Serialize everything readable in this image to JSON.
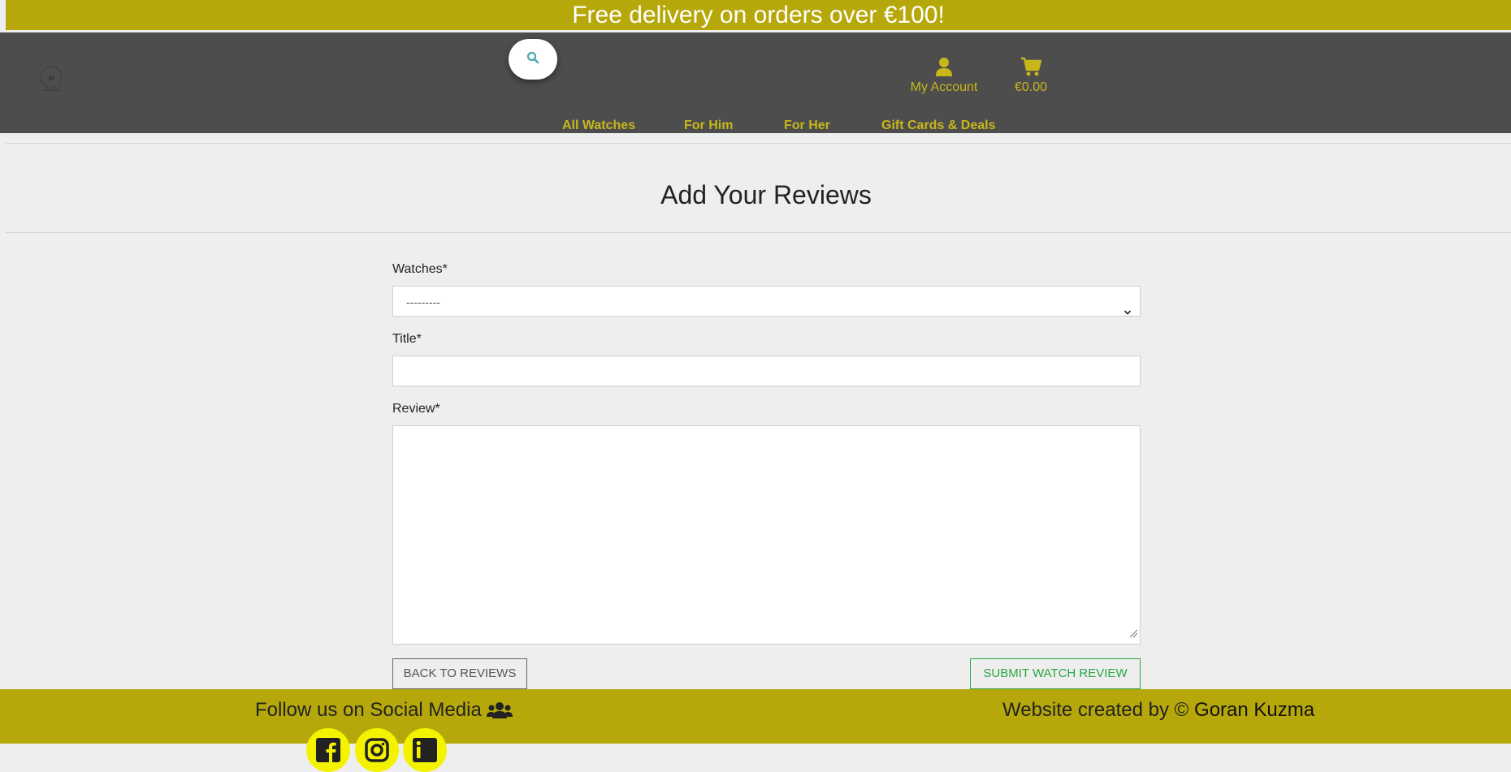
{
  "promo": {
    "text": "Free delivery on orders over €100!"
  },
  "header": {
    "logo_icon": "watch-brand-logo",
    "search_icon": "search-icon",
    "account": {
      "icon": "user-icon",
      "label": "My Account"
    },
    "cart": {
      "icon": "shopping-cart-icon",
      "total": "€0.00"
    },
    "nav": [
      {
        "label": "All Watches"
      },
      {
        "label": "For Him"
      },
      {
        "label": "For Her"
      },
      {
        "label": "Gift Cards & Deals"
      }
    ]
  },
  "main": {
    "title": "Add Your Reviews",
    "form": {
      "watches_label": "Watches*",
      "watches_selected": "---------",
      "title_label": "Title*",
      "title_value": "",
      "review_label": "Review*",
      "review_value": ""
    },
    "buttons": {
      "back": "BACK TO REVIEWS",
      "submit": "SUBMIT WATCH REVIEW"
    }
  },
  "footer": {
    "follow_text": "Follow us on Social Media",
    "follow_icon": "users-icon",
    "credit_prefix": "Website created by ©",
    "credit_name": "Goran Kuzma",
    "social": [
      {
        "icon": "facebook-icon"
      },
      {
        "icon": "instagram-icon"
      },
      {
        "icon": "linkedin-icon"
      }
    ]
  },
  "colors": {
    "accent": "#b6a80a",
    "header_bg": "#4d4d4d",
    "nav_text": "#c8b71a",
    "submit_green": "#28a745",
    "page_bg": "#eeeeee"
  }
}
